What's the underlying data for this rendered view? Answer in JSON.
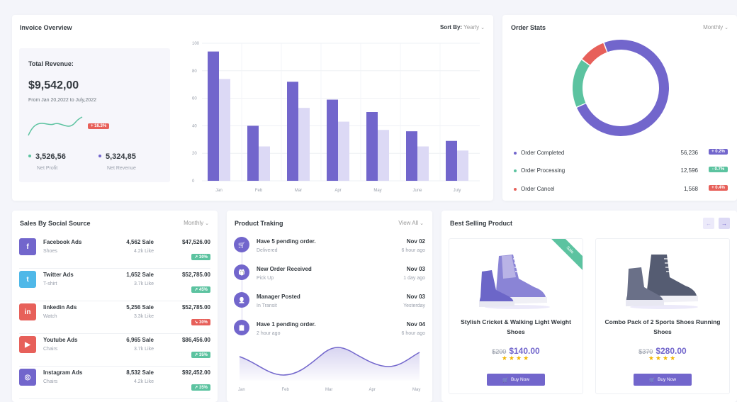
{
  "colors": {
    "primary": "#7266cc",
    "light": "#dcd9f5",
    "success": "#5cc3a0",
    "danger": "#e7605a",
    "info": "#4fb8e8"
  },
  "invoice": {
    "title": "Invoice Overview",
    "sort_label": "Sort By:",
    "sort_value": "Yearly",
    "revenue_label": "Total Revenue:",
    "revenue_value": "$9,542,00",
    "revenue_range": "From Jan 20,2022 to July,2022",
    "revenue_badge": "+ 16.3%",
    "net_profit_value": "3,526,56",
    "net_profit_label": "Net Profit",
    "net_revenue_value": "5,324,85",
    "net_revenue_label": "Net Revenue"
  },
  "chart_data": {
    "type": "bar",
    "categories": [
      "Jan",
      "Feb",
      "Mar",
      "Apr",
      "May",
      "June",
      "July"
    ],
    "series": [
      {
        "values": [
          94,
          40,
          72,
          59,
          50,
          36,
          29
        ]
      },
      {
        "values": [
          74,
          25,
          53,
          43,
          37,
          25,
          22
        ]
      }
    ],
    "yticks": [
      "0",
      "20",
      "40",
      "60",
      "80",
      "100"
    ],
    "ylim": [
      0,
      100
    ],
    "grid": true
  },
  "order_stats": {
    "title": "Order Stats",
    "period": "Monthly",
    "donut": [
      {
        "label": "Order Completed",
        "value": 56236,
        "value_text": "56,236",
        "badge": "+ 0.2%",
        "color": "#7266cc",
        "badge_color": "#7266cc"
      },
      {
        "label": "Order Processing",
        "value": 12596,
        "value_text": "12,596",
        "badge": "- 0.7%",
        "color": "#5cc3a0",
        "badge_color": "#5cc3a0"
      },
      {
        "label": "Order Cancel",
        "value": 1568,
        "value_text": "1,568",
        "badge": "+ 0.4%",
        "color": "#e7605a",
        "badge_color": "#e7605a"
      }
    ]
  },
  "social": {
    "title": "Sales By Social Source",
    "period": "Monthly",
    "rows": [
      {
        "name": "Facebook Ads",
        "sub": "Shoes",
        "sale": "4,562 Sale",
        "like": "4.2k Like",
        "amount": "$47,526.00",
        "pct": "↗ 30%",
        "pct_color": "#5cc3a0",
        "icon": "facebook-icon",
        "glyph": "f",
        "bg": "#7266cc"
      },
      {
        "name": "Twitter Ads",
        "sub": "T-shirt",
        "sale": "1,652 Sale",
        "like": "3.7k Like",
        "amount": "$52,785.00",
        "pct": "↗ 45%",
        "pct_color": "#5cc3a0",
        "icon": "twitter-icon",
        "glyph": "t",
        "bg": "#4fb8e8"
      },
      {
        "name": "linkedin Ads",
        "sub": "Watch",
        "sale": "5,256 Sale",
        "like": "3.3k Like",
        "amount": "$52,785.00",
        "pct": "↘ 30%",
        "pct_color": "#e7605a",
        "icon": "linkedin-icon",
        "glyph": "in",
        "bg": "#e7605a"
      },
      {
        "name": "Youtube Ads",
        "sub": "Chairs",
        "sale": "6,965 Sale",
        "like": "3.7k Like",
        "amount": "$86,456.00",
        "pct": "↗ 35%",
        "pct_color": "#5cc3a0",
        "icon": "youtube-icon",
        "glyph": "▶",
        "bg": "#e7605a"
      },
      {
        "name": "Instagram Ads",
        "sub": "Chairs",
        "sale": "8,532 Sale",
        "like": "4.2k Like",
        "amount": "$92,452.00",
        "pct": "↗ 35%",
        "pct_color": "#5cc3a0",
        "icon": "instagram-icon",
        "glyph": "◎",
        "bg": "#7266cc"
      }
    ]
  },
  "tracking": {
    "title": "Product Traking",
    "view_all": "View All",
    "items": [
      {
        "title": "Have 5 pending order.",
        "sub": "Delivered",
        "date": "Nov 02",
        "rel": "6 hour ago",
        "icon": "cart-icon"
      },
      {
        "title": "New Order Received",
        "sub": "Pick Up",
        "date": "Nov 03",
        "rel": "1 day ago",
        "icon": "gift-icon"
      },
      {
        "title": "Manager Posted",
        "sub": "In Transit",
        "date": "Nov 03",
        "rel": "Yesterday",
        "icon": "user-icon"
      },
      {
        "title": "Have 1 pending order.",
        "sub": "2 hour ago",
        "date": "Nov 04",
        "rel": "6 hour ago",
        "icon": "clipboard-icon"
      }
    ],
    "months": [
      "Jan",
      "Feb",
      "Mar",
      "Apr",
      "May"
    ]
  },
  "best": {
    "title": "Best Selling Product",
    "products": [
      {
        "name": "Stylish Cricket & Walking Light Weight Shoes",
        "old": "$200",
        "price": "$140.00",
        "stars": "★★★★",
        "btn": "Buy Now",
        "ribbon": "Sale"
      },
      {
        "name": "Combo Pack of 2 Sports Shoes Running Shoes",
        "old": "$370",
        "price": "$280.00",
        "stars": "★★★★",
        "btn": "Buy Now"
      }
    ]
  }
}
